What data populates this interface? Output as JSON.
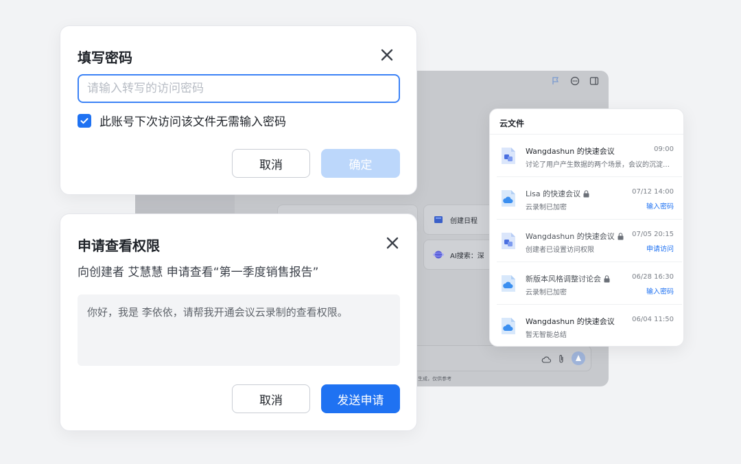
{
  "colors": {
    "accent": "#1f72f2",
    "disabled_accent": "#bcd7fb",
    "page_bg": "#f2f3f5"
  },
  "password_dialog": {
    "title": "填写密码",
    "input_placeholder": "请输入转写的访问密码",
    "remember_checked": true,
    "remember_label": "此账号下次访问该文件无需输入密码",
    "cancel_label": "取消",
    "confirm_label": "确定"
  },
  "request_dialog": {
    "title": "申请查看权限",
    "subtitle": "向创建者 艾慧慧 申请查看“第一季度销售报告”",
    "message": "你好，我是 李依依，请帮我开通会议云录制的查看权限。",
    "cancel_label": "取消",
    "send_label": "发送申请"
  },
  "background_app": {
    "cards": [
      {
        "icon": "book-icon",
        "label": "创建日程"
      },
      {
        "icon": "planet-icon",
        "label": "AI搜索：深"
      }
    ],
    "footnote": "AI 生成，仅供参考"
  },
  "cloud_panel": {
    "title": "云文件",
    "items": [
      {
        "name": "Wangdashun 的快速会议",
        "time": "09:00",
        "desc": "讨论了用户产生数据的两个场景，会议的沉淀…",
        "locked": false,
        "action": "",
        "icon": "meeting-doc-icon",
        "dim": false
      },
      {
        "name": "Lisa 的快速会议",
        "time": "07/12 14:00",
        "desc": "云录制已加密",
        "locked": true,
        "action": "输入密码",
        "icon": "cloud-doc-icon",
        "dim": true
      },
      {
        "name": "Wangdashun 的快速会议",
        "time": "07/05 20:15",
        "desc": "创建者已设置访问权限",
        "locked": true,
        "action": "申请访问",
        "icon": "meeting-doc-icon",
        "dim": true
      },
      {
        "name": "新版本风格调整讨论会",
        "time": "06/28 16:30",
        "desc": "云录制已加密",
        "locked": true,
        "action": "输入密码",
        "icon": "cloud-doc-icon",
        "dim": true
      },
      {
        "name": "Wangdashun 的快速会议",
        "time": "06/04  11:50",
        "desc": "暂无智能总结",
        "locked": false,
        "action": "",
        "icon": "cloud-doc-icon",
        "dim": false
      }
    ]
  }
}
